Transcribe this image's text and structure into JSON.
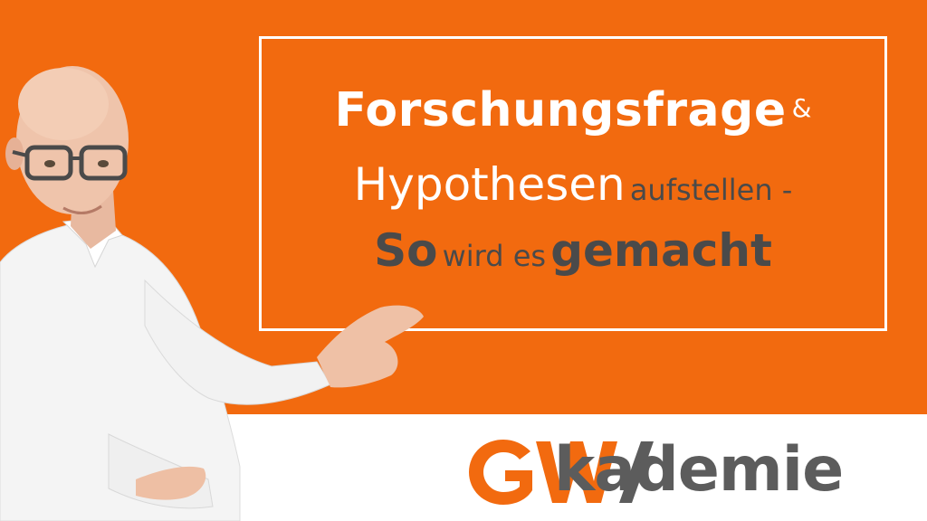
{
  "title": {
    "line1_bold": "Forschungsfrage",
    "line1_amp": "&",
    "line2_main": "Hypothesen",
    "line2_rest": "aufstellen -",
    "line3_so": "So",
    "line3_middle": "wird es",
    "line3_end": "gemacht"
  },
  "logo": {
    "word": "kademie"
  },
  "colors": {
    "orange": "#f26a0f",
    "dark_text": "#4a4a4a",
    "white": "#ffffff"
  }
}
